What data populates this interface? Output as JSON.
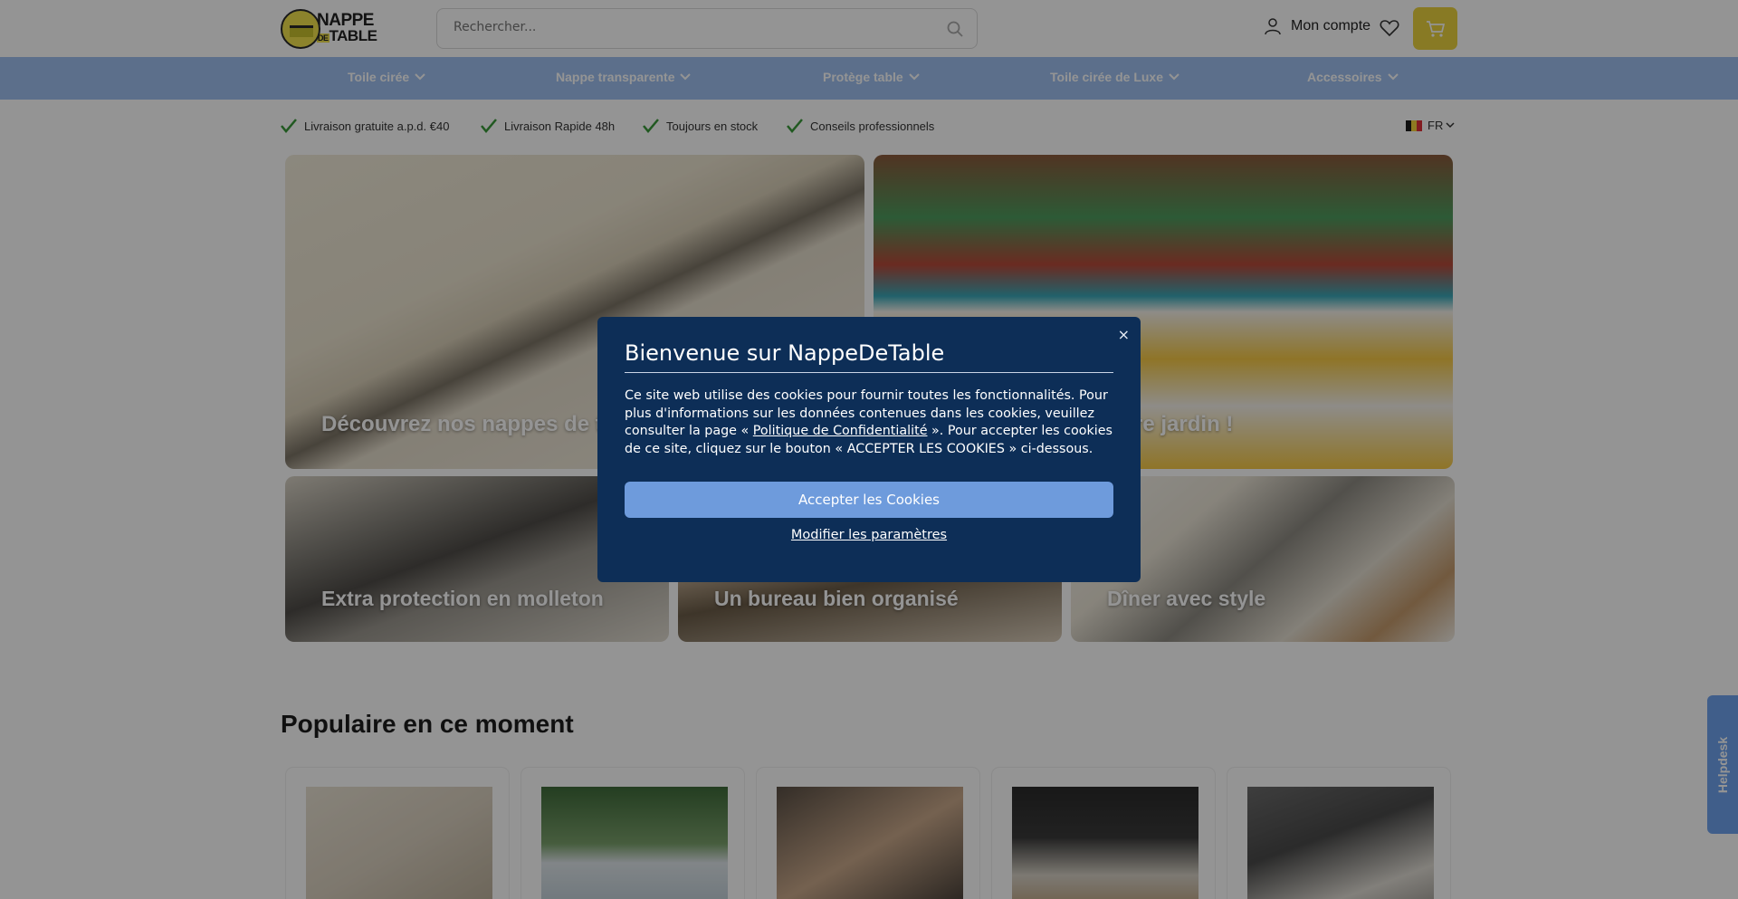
{
  "header": {
    "logo_line1": "NAPPE",
    "logo_de": "DE",
    "logo_line2": "TABLE",
    "search_placeholder": "Rechercher...",
    "account_label": "Mon compte"
  },
  "nav": {
    "items": [
      {
        "label": "Toile cirée"
      },
      {
        "label": "Nappe transparente"
      },
      {
        "label": "Protège table"
      },
      {
        "label": "Toile cirée de Luxe"
      },
      {
        "label": "Accessoires"
      }
    ]
  },
  "usp": {
    "items": [
      {
        "label": "Livraison gratuite a.p.d. €40"
      },
      {
        "label": "Livraison Rapide 48h"
      },
      {
        "label": "Toujours en stock"
      },
      {
        "label": "Conseils professionnels"
      }
    ],
    "language": "FR",
    "check_color": "#3a9a3a"
  },
  "hero": {
    "tile1": "Découvrez nos nappes de table",
    "tile2": "Le beau de votre jardin !",
    "tile3": "Extra protection en molleton",
    "tile4": "Un bureau bien organisé",
    "tile5": "Dîner avec style"
  },
  "popular": {
    "title": "Populaire en ce moment"
  },
  "helpdesk": {
    "label": "Helpdesk"
  },
  "cookie_modal": {
    "title": "Bienvenue sur NappeDeTable",
    "text_before": "Ce site web utilise des cookies pour fournir toutes les fonctionnalités. Pour plus d'informations sur les données contenues dans les cookies, veuillez consulter la page « ",
    "policy_link": "Politique de Confidentialité",
    "text_after": " ». Pour accepter les cookies de ce site, cliquez sur le bouton « ACCEPTER LES COOKIES » ci-dessous.",
    "accept_label": "Accepter les Cookies",
    "modify_label": "Modifier les paramètres",
    "close_label": "×",
    "background_color": "#0d2e57",
    "button_color": "#6e9bdc"
  },
  "colors": {
    "nav_bg": "#9fc0ef",
    "cart_bg": "#ebd33f",
    "helpdesk_bg": "#6fa3ee"
  }
}
